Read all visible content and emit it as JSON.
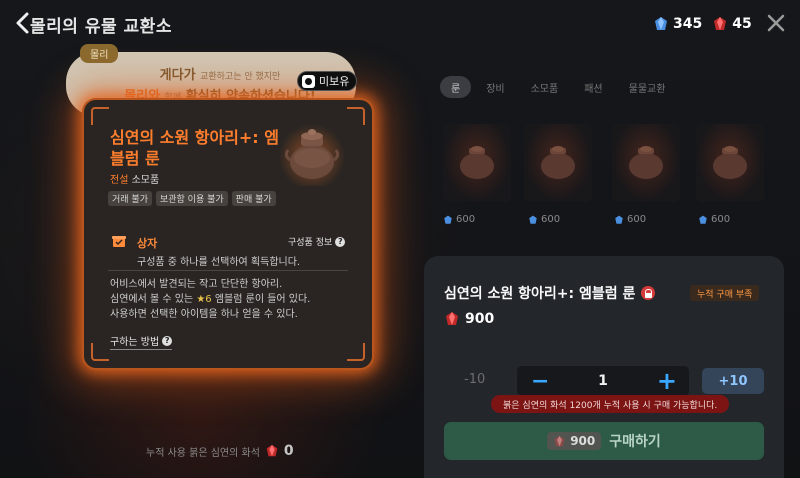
{
  "header": {
    "title": "몰리의 유물 교환소",
    "blue_currency": "345",
    "red_currency": "45"
  },
  "npc": {
    "name": "몰리",
    "line1_bold": "게다가",
    "line1_small": "교환하고는 안 했지만",
    "line2_name": "몰리와",
    "line2_small": "함께",
    "line2_rest": "확실히 약속하셨습니다!"
  },
  "badge": {
    "unowned": "미보유"
  },
  "tooltip": {
    "name": "심연의 소원 항아리+: 엠블럼 룬",
    "grade": "전설",
    "type": "소모품",
    "tags": [
      "거래 불가",
      "보관함 이용 불가",
      "판매 불가"
    ],
    "box_label": "상자",
    "contents_info": "구성품 정보",
    "select_desc": "구성품 중 하나를 선택하여 획득합니다.",
    "lore_1": "어비스에서 발견되는 작고 단단한 항아리.",
    "lore_2a": "심연에서 볼 수 있는",
    "lore_2b": "★6",
    "lore_2c": "엠블럼 룬이 들어 있다.",
    "lore_3": "사용하면 선택한 아이템을 하나 얻을 수 있다.",
    "howto": "구하는 방법"
  },
  "tabs": [
    {
      "label": "룬",
      "active": true
    },
    {
      "label": "장비",
      "active": false
    },
    {
      "label": "소모품",
      "active": false
    },
    {
      "label": "패션",
      "active": false
    },
    {
      "label": "물물교환",
      "active": false
    }
  ],
  "grid": {
    "prices": [
      "600",
      "600",
      "600",
      "600"
    ]
  },
  "purchase": {
    "title": "심연의 소원 항아리+: 엠블럼 룬",
    "limit_badge": "누적 구매 부족",
    "price": "900",
    "minus10": "-10",
    "quantity": "1",
    "plus10": "+10",
    "warning": "붉은 심연의 화석 1200개 누적 사용 시 구매 가능합니다.",
    "buy_price": "900",
    "buy_label": "구매하기"
  },
  "accumulated": {
    "label": "누적 사용 붉은 심연의 화석",
    "value": "0"
  },
  "colors": {
    "accent_orange": "#ff7e2d",
    "buy_green": "#2e5b47",
    "stepper_blue": "#3aa7ff",
    "warning_red": "#7d1414"
  }
}
